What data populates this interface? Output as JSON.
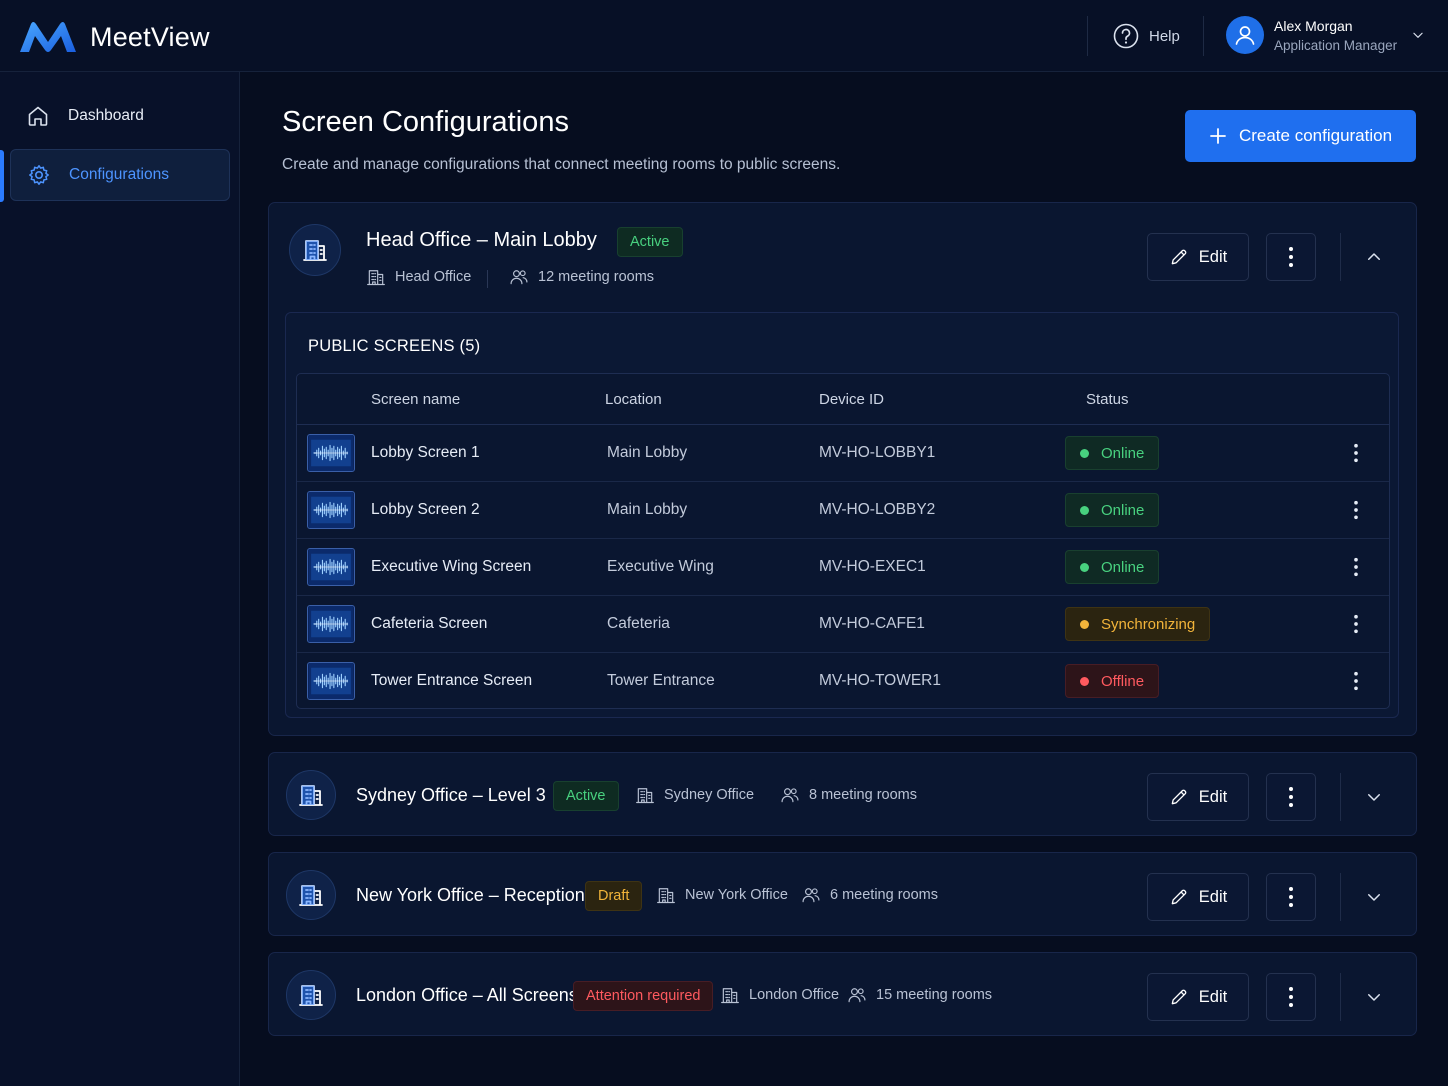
{
  "app": {
    "name": "MeetView"
  },
  "header": {
    "help_label": "Help",
    "user": {
      "name": "Alex Morgan",
      "role": "Application Manager"
    }
  },
  "sidebar": {
    "items": [
      {
        "label": "Dashboard",
        "icon": "home-icon",
        "active": false
      },
      {
        "label": "Configurations",
        "icon": "gear-icon",
        "active": true
      }
    ]
  },
  "page": {
    "title": "Screen Configurations",
    "subtitle": "Create and manage configurations that connect meeting rooms to public screens.",
    "create_label": "Create configuration"
  },
  "edit_label": "Edit",
  "configs": [
    {
      "title": "Head Office – Main Lobby",
      "status": "Active",
      "office": "Head Office",
      "rooms": "12 meeting rooms",
      "expanded": true,
      "public_screens": {
        "title": "PUBLIC SCREENS (5)",
        "columns": [
          "Screen name",
          "Location",
          "Device ID",
          "Status"
        ],
        "rows": [
          {
            "name": "Lobby Screen 1",
            "location": "Main Lobby",
            "device_id": "MV-HO-LOBBY1",
            "status": "Online"
          },
          {
            "name": "Lobby Screen 2",
            "location": "Main Lobby",
            "device_id": "MV-HO-LOBBY2",
            "status": "Online"
          },
          {
            "name": "Executive Wing Screen",
            "location": "Executive Wing",
            "device_id": "MV-HO-EXEC1",
            "status": "Online"
          },
          {
            "name": "Cafeteria Screen",
            "location": "Cafeteria",
            "device_id": "MV-HO-CAFE1",
            "status": "Synchronizing"
          },
          {
            "name": "Tower Entrance Screen",
            "location": "Tower Entrance",
            "device_id": "MV-HO-TOWER1",
            "status": "Offline"
          }
        ]
      }
    },
    {
      "title": "Sydney Office – Level 3",
      "status": "Active",
      "office": "Sydney Office",
      "rooms": "8 meeting rooms",
      "expanded": false
    },
    {
      "title": "New York Office – Reception",
      "status": "Draft",
      "office": "New York Office",
      "rooms": "6 meeting rooms",
      "expanded": false
    },
    {
      "title": "London Office – All Screens",
      "status": "Attention required",
      "office": "London Office",
      "rooms": "15 meeting rooms",
      "expanded": false
    }
  ],
  "colors": {
    "accent": "#1f6fef",
    "online": "#48d17f",
    "synchronizing": "#f2b43a",
    "offline": "#ff5a5f"
  }
}
